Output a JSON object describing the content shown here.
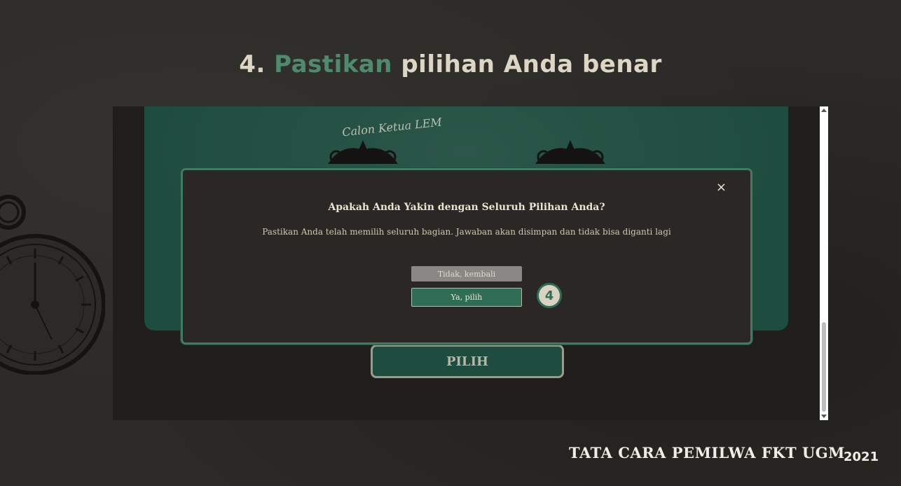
{
  "slide": {
    "step_prefix": "4.",
    "title_accent": "Pastikan",
    "title_rest": "pilihan Anda benar"
  },
  "screen": {
    "card_label": "Calon Ketua LEM",
    "main_button_label": "PILIH",
    "modal": {
      "close_symbol": "×",
      "title": "Apakah Anda Yakin dengan Seluruh Pilihan Anda?",
      "text": "Pastikan Anda telah memilih seluruh bagian. Jawaban akan disimpan dan tidak bisa diganti lagi",
      "cancel_label": "Tidak, kembali",
      "confirm_label": "Ya, pilih"
    },
    "step_badge": "4"
  },
  "footer": {
    "title": "TATA CARA PEMILWA FKT UGM",
    "year": "2021"
  },
  "icons": [
    "close-icon",
    "pocket-watch-icon",
    "ornament-icon"
  ],
  "colors": {
    "accent_green": "#4f8a6e",
    "card_green": "#1e4c3e",
    "confirm_green": "#2f6e55",
    "background": "#2c2a27"
  }
}
